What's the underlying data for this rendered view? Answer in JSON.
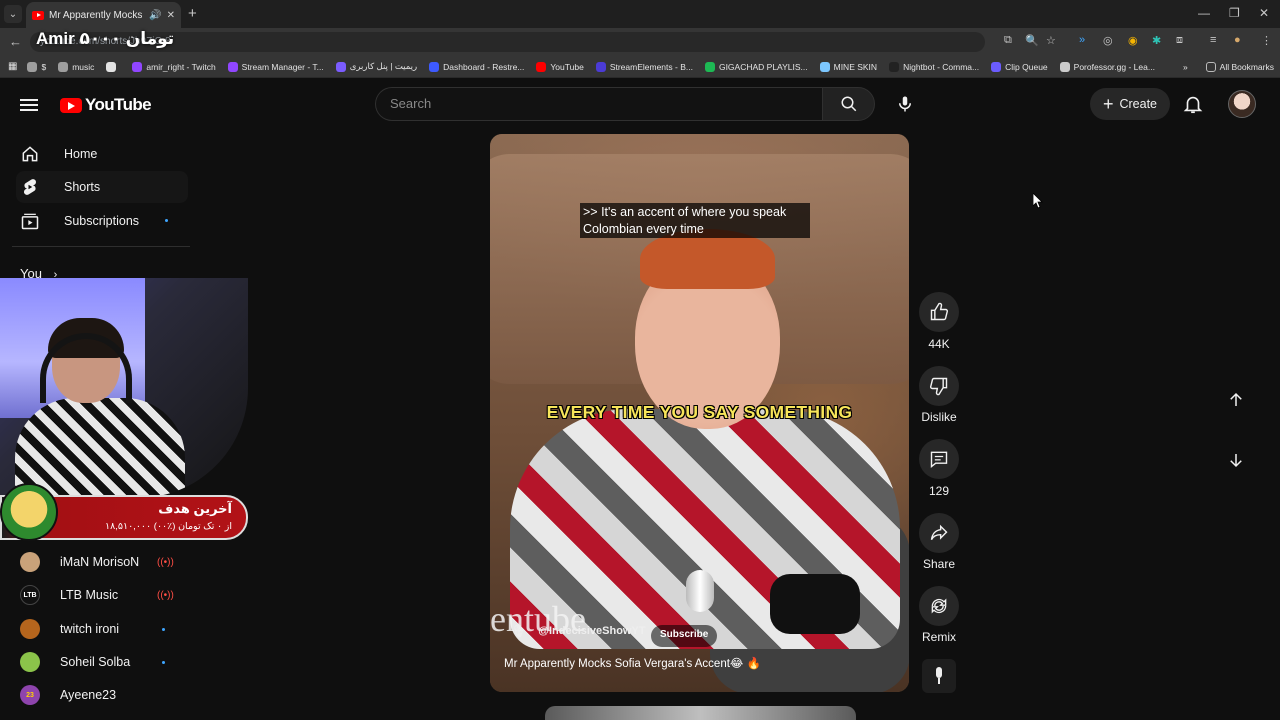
{
  "browser": {
    "tab_title": "Mr Apparently Mocks Sofia",
    "url": "youtube.com/shorts/Jb9ZiC-8",
    "overlay_text": "Amir ۵۰۰۰ تومان",
    "bookmarks": [
      {
        "label": "$",
        "color": "#9e9e9e"
      },
      {
        "label": "music",
        "color": "#9e9e9e"
      },
      {
        "label": "",
        "color": "#e3e3e3"
      },
      {
        "label": "amir_right - Twitch",
        "color": "#9146ff"
      },
      {
        "label": "Stream Manager - T...",
        "color": "#9146ff"
      },
      {
        "label": "ریمیت | پنل کاربری",
        "color": "#7b5cff"
      },
      {
        "label": "Dashboard - Restre...",
        "color": "#3d5afe"
      },
      {
        "label": "YouTube",
        "color": "#ff0000"
      },
      {
        "label": "StreamElements - B...",
        "color": "#4b3bd6"
      },
      {
        "label": "GIGACHAD PLAYLIS...",
        "color": "#1db954"
      },
      {
        "label": "MINE SKIN",
        "color": "#7cc7ff"
      },
      {
        "label": "Nightbot - Comma...",
        "color": "#222222"
      },
      {
        "label": "Clip Queue",
        "color": "#6b5cff"
      },
      {
        "label": "Porofessor.gg - Lea...",
        "color": "#cccccc"
      }
    ],
    "all_bookmarks": "All Bookmarks"
  },
  "masthead": {
    "logo": "YouTube",
    "search_placeholder": "Search",
    "create_label": "Create"
  },
  "sidebar": {
    "items": [
      {
        "label": "Home"
      },
      {
        "label": "Shorts"
      },
      {
        "label": "Subscriptions"
      }
    ],
    "you_label": "You",
    "channels": [
      {
        "name": "iMaN MorisoN",
        "live": true,
        "color": "#c9a27a"
      },
      {
        "name": "LTB Music",
        "live": true,
        "color": "#111111",
        "abbr": "LTB"
      },
      {
        "name": "twitch ironi",
        "live": false,
        "color": "#b5651d"
      },
      {
        "name": "Soheil Solba",
        "live": false,
        "color": "#8bc34a"
      },
      {
        "name": "Ayeene23",
        "live": false,
        "color": "#8e44ad",
        "abbr": "23"
      }
    ]
  },
  "goal": {
    "title": "آخرین هدف",
    "detail": "۱۸,۵۱۰,۰۰۰ از ۰ تک تومان (٪۰۰)"
  },
  "video": {
    "caption_line1": ">> It's an accent of where you speak",
    "caption_line2": "Colombian every time",
    "overlay_text": "EVERY TIME YOU SAY SOMETHING",
    "watermark": "entube",
    "channel": "@IndecisiveShowYT",
    "subscribe_label": "Subscribe",
    "title": "Mr Apparently Mocks Sofia Vergara's Accent😂 🔥"
  },
  "actions": {
    "like_count": "44K",
    "dislike_label": "Dislike",
    "comment_count": "129",
    "share_label": "Share",
    "remix_label": "Remix"
  }
}
